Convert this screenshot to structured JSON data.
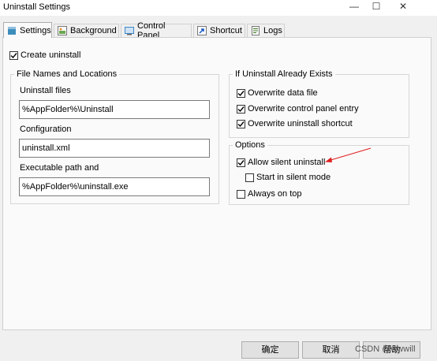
{
  "window": {
    "title": "Uninstall Settings",
    "minimize": "—",
    "maximize": "☐",
    "close": "✕"
  },
  "tabs": [
    {
      "label": "Settings",
      "icon": "settings-icon"
    },
    {
      "label": "Background",
      "icon": "background-icon"
    },
    {
      "label": "Control Panel",
      "icon": "control-panel-icon"
    },
    {
      "label": "Shortcut",
      "icon": "shortcut-icon"
    },
    {
      "label": "Logs",
      "icon": "logs-icon"
    }
  ],
  "create_uninstall": {
    "label": "Create uninstall",
    "checked": true
  },
  "file_names": {
    "legend": "File Names and Locations",
    "uninstall_files_label": "Uninstall files",
    "uninstall_files_value": "%AppFolder%\\Uninstall",
    "configuration_label": "Configuration",
    "configuration_value": "uninstall.xml",
    "exec_path_label": "Executable path and",
    "exec_path_value": "%AppFolder%\\uninstall.exe"
  },
  "already_exists": {
    "legend": "If Uninstall Already Exists",
    "items": [
      {
        "label": "Overwrite data file",
        "checked": true
      },
      {
        "label": "Overwrite control panel entry",
        "checked": true
      },
      {
        "label": "Overwrite uninstall shortcut",
        "checked": true
      }
    ]
  },
  "options": {
    "legend": "Options",
    "allow_silent": {
      "label": "Allow silent uninstall",
      "checked": true
    },
    "start_silent": {
      "label": "Start in silent mode",
      "checked": false
    },
    "always_on_top": {
      "label": "Always on top",
      "checked": false
    }
  },
  "buttons": {
    "ok": "确定",
    "cancel": "取消",
    "help": "帮助"
  },
  "watermark": "CSDN @wwwill",
  "colors": {
    "accent": "#0078d7",
    "arrow": "#e02020"
  }
}
